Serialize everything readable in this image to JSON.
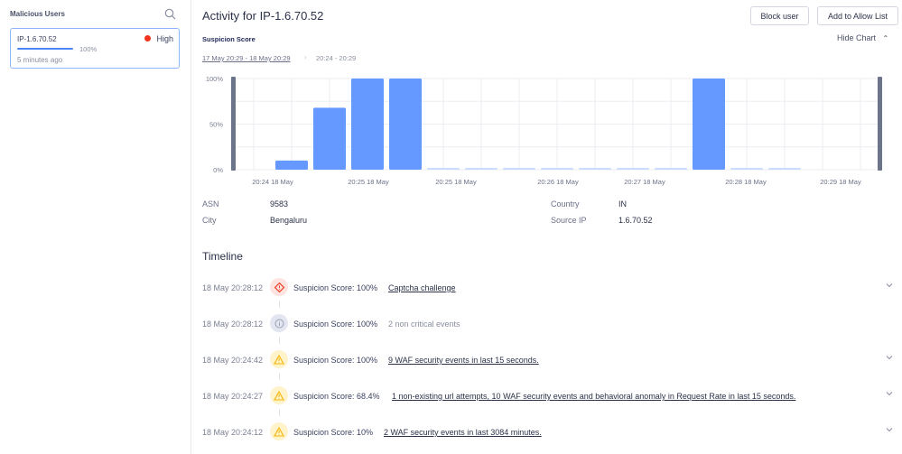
{
  "sidebar": {
    "title": "Malicious Users",
    "users": [
      {
        "ip": "IP-1.6.70.52",
        "level": "High",
        "score": "100%",
        "score_value": 100,
        "time": "5 minutes ago"
      }
    ]
  },
  "header": {
    "title": "Activity for IP-1.6.70.52",
    "block_label": "Block user",
    "allow_label": "Add to Allow List"
  },
  "chart_section": {
    "label": "Suspicion Score",
    "hide_label": "Hide Chart",
    "range": "17 May 20:29 - 18 May 20:29",
    "subrange": "20:24 - 20:29"
  },
  "chart_data": {
    "type": "bar",
    "title": "Suspicion Score",
    "ylim": [
      0,
      100
    ],
    "yticks": [
      "100%",
      "50%",
      "0%"
    ],
    "values": [
      0,
      10,
      68,
      100,
      100,
      1,
      1,
      1,
      1,
      1,
      1,
      1,
      100,
      1,
      1,
      0
    ],
    "xticks": [
      "20:24 18 May",
      "20:25 18 May",
      "20:25 18 May",
      "20:26 18 May",
      "20:27 18 May",
      "20:28 18 May",
      "20:29 18 May"
    ],
    "bar_color": "#6699ff",
    "faint_color": "#c9dbff"
  },
  "details": {
    "asn_label": "ASN",
    "asn": "9583",
    "city_label": "City",
    "city": "Bengaluru",
    "country_label": "Country",
    "country": "IN",
    "source_label": "Source IP",
    "source": "1.6.70.52"
  },
  "timeline": {
    "title": "Timeline",
    "items": [
      {
        "time": "18 May 20:28:12",
        "icon": "captcha-icon",
        "score": "Suspicion Score: 100%",
        "desc": "Captcha challenge"
      },
      {
        "time": "18 May 20:28:12",
        "icon": "info-icon",
        "score": "Suspicion Score: 100%",
        "desc": "2 non critical events"
      },
      {
        "time": "18 May 20:24:42",
        "icon": "warning-icon",
        "score": "Suspicion Score: 100%",
        "desc": "9 WAF security events in last 15 seconds."
      },
      {
        "time": "18 May 20:24:27",
        "icon": "warning-icon",
        "score": "Suspicion Score: 68.4%",
        "desc": "1 non-existing url attempts, 10 WAF security events and behavioral anomaly in Request Rate in last 15 seconds."
      },
      {
        "time": "18 May 20:24:12",
        "icon": "warning-icon",
        "score": "Suspicion Score: 10%",
        "desc": "2 WAF security events in last 3084 minutes."
      }
    ]
  }
}
